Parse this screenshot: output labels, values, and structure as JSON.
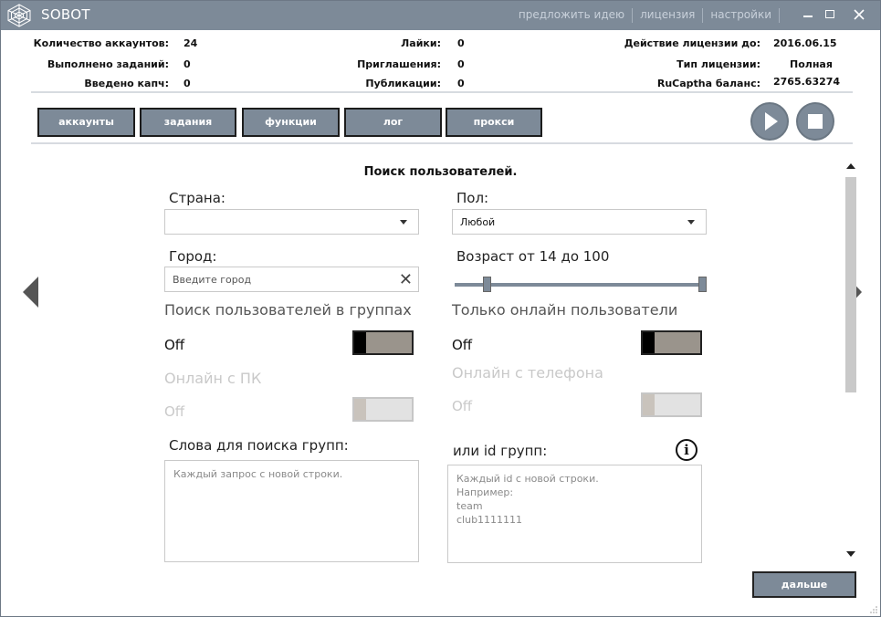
{
  "app": {
    "title": "SOBOT"
  },
  "top_links": [
    "предложить идею",
    "лицензия",
    "настройки"
  ],
  "stats": {
    "accounts_label": "Количество аккаунтов:",
    "accounts_value": "24",
    "tasks_label": "Выполнено заданий:",
    "tasks_value": "0",
    "captcha_label": "Введено капч:",
    "captcha_value": "0",
    "likes_label": "Лайки:",
    "likes_value": "0",
    "invites_label": "Приглашения:",
    "invites_value": "0",
    "posts_label": "Публикации:",
    "posts_value": "0",
    "license_until_label": "Действие лицензии до:",
    "license_until_value": "2016.06.15",
    "license_type_label": "Тип лицензии:",
    "license_type_value": "Полная",
    "rucaptcha_label": "RuCaptha баланс:",
    "rucaptcha_value": "2765.63274"
  },
  "tabs": [
    "аккаунты",
    "задания",
    "функции",
    "лог",
    "прокси"
  ],
  "section_title": "Поиск пользователей.",
  "form": {
    "country_label": "Страна:",
    "country_value": "",
    "gender_label": "Пол:",
    "gender_value": "Любой",
    "city_label": "Город:",
    "city_placeholder": "Введите город",
    "age_label": "Возраст от 14 до 100",
    "age_min": 14,
    "age_max": 100,
    "search_in_groups_label": "Поиск пользователей в группах",
    "search_in_groups_state": "Off",
    "online_only_label": "Только онлайн пользователи",
    "online_only_state": "Off",
    "online_pc_label": "Онлайн с ПК",
    "online_pc_state": "Off",
    "online_phone_label": "Онлайн с телефона",
    "online_phone_state": "Off",
    "group_words_label": "Слова для поиска групп:",
    "group_words_placeholder": "Каждый запрос с новой строки.",
    "group_ids_label": "или id групп:",
    "group_ids_placeholder": "Каждый id с новой строки.\nНапример:\nteam\nclub1111111"
  },
  "next_button": "дальше",
  "colors": {
    "accent": "#7d8a98",
    "toggle_off": "#9a948c"
  }
}
